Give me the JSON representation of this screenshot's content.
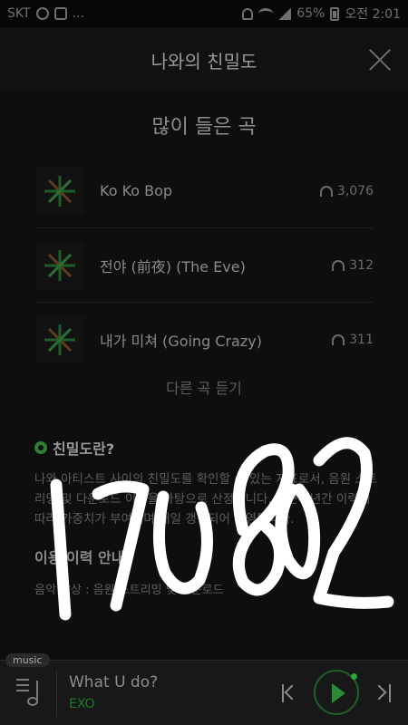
{
  "status_bar": {
    "carrier": "SKT",
    "dots": "...",
    "battery": "65%",
    "time": "오전 2:01"
  },
  "header": {
    "title": "나와의 친밀도"
  },
  "top_songs": {
    "title": "많이 들은 곡",
    "songs": [
      {
        "title": "Ko Ko Bop",
        "plays": "3,076"
      },
      {
        "title": "전야 (前夜) (The Eve)",
        "plays": "312"
      },
      {
        "title": "내가 미쳐 (Going Crazy)",
        "plays": "311"
      }
    ],
    "more_label": "다른 곡 듣기"
  },
  "info": {
    "heading": "친밀도란?",
    "body": "나와 아티스트 사이의 친밀도를 확인할 수 있는 지표로서, 음원 스트리밍 및 다운로드 이력을 바탕으로 산정됩니다. 최근 1년간 이력에 따라 가중치가 부여되며 매일 갱신되어 반영됩니다.",
    "usage_heading": "이용 이력 안내",
    "usage_line": "음악 감상 : 음원 스트리밍 및 다운로드"
  },
  "overlay": {
    "handwritten_text": "170802"
  },
  "player": {
    "badge": "music",
    "track_title": "What U do?",
    "artist": "EXO"
  },
  "colors": {
    "accent_green": "#1e7a2a",
    "handwriting": "#ffffff"
  },
  "icons": [
    "chat-icon",
    "sim-icon",
    "mute-icon",
    "wifi-icon",
    "signal-icon",
    "battery-icon",
    "close-icon",
    "headphone-icon",
    "leaf-icon",
    "music-note-icon",
    "previous-icon",
    "play-icon",
    "next-icon"
  ]
}
